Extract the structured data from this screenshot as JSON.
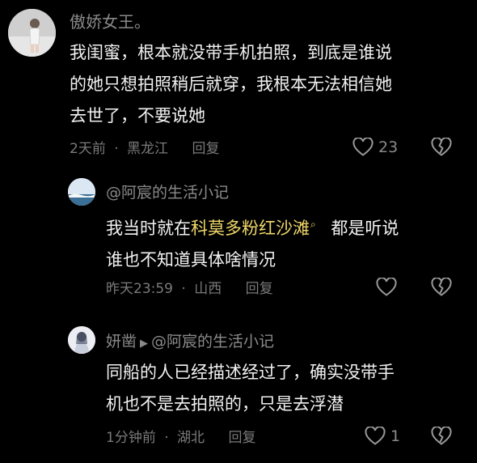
{
  "comments": [
    {
      "username": "傲娇女王。",
      "lines": [
        "我闺蜜，根本就没带手机拍照，到底是谁说",
        "的她只想拍照稍后就穿，我根本无法相信她",
        "去世了，不要说她"
      ],
      "time": "2天前",
      "location": "黑龙江",
      "reply_label": "回复",
      "like_count": "23",
      "like_icon": "heart-outline-icon",
      "dislike_icon": "broken-heart-icon"
    },
    {
      "username": "@阿宸的生活小记",
      "line1_prefix": "我当时就在",
      "line1_link": "科莫多粉红沙滩",
      "line1_suffix": "都是听说",
      "line2": "谁也不知道具体啥情况",
      "time": "昨天23:59",
      "location": "山西",
      "reply_label": "回复",
      "like_count": "",
      "like_icon": "heart-outline-icon",
      "dislike_icon": "broken-heart-icon"
    },
    {
      "username": "妍凿",
      "reply_to": "@阿宸的生活小记",
      "lines": [
        "同船的人已经描述经过了，确实没带手",
        "机也不是去拍照的，只是去浮潜"
      ],
      "time": "1分钟前",
      "location": "湖北",
      "reply_label": "回复",
      "like_count": "1",
      "like_icon": "heart-outline-icon",
      "dislike_icon": "broken-heart-icon"
    }
  ],
  "separator": "·",
  "colors": {
    "background": "#000000",
    "text": "#f2f2f2",
    "muted": "#7a7a7a",
    "link": "#f1d86a"
  }
}
